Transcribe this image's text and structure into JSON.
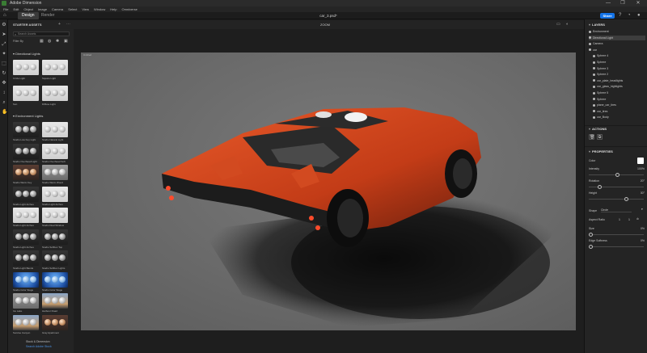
{
  "os": {
    "title": "Adobe Dimension",
    "window_controls": [
      "—",
      "❐",
      "✕"
    ]
  },
  "menu": [
    "File",
    "Edit",
    "Object",
    "Image",
    "Camera",
    "Select",
    "View",
    "Window",
    "Help",
    "Omniverse"
  ],
  "header": {
    "tabs": [
      {
        "label": "Design",
        "active": true
      },
      {
        "label": "Render",
        "active": false
      }
    ],
    "filename": "car_3.psd*",
    "share_label": "Share"
  },
  "subhead": {
    "panel_title": "STARTER ASSETS",
    "zoom": "ZOOM"
  },
  "assets": {
    "search_placeholder": "Search Assets",
    "filter_label": "Filter By",
    "section_directional": "Directional Lights",
    "directional": [
      {
        "label": "Circle Light",
        "style": "light"
      },
      {
        "label": "Square Light",
        "style": "light"
      },
      {
        "label": "Sun",
        "style": "light"
      },
      {
        "label": "Diffuse Light",
        "style": "light"
      }
    ],
    "section_environment": "Environment Lights",
    "environment": [
      {
        "label": "Studio Low Key Light",
        "style": "dark"
      },
      {
        "label": "Studio Natural Light",
        "style": "light"
      },
      {
        "label": "Studio Overhead Light",
        "style": "dark"
      },
      {
        "label": "Studio Overhead Soft",
        "style": "light"
      },
      {
        "label": "Studio Warm Key",
        "style": "warm"
      },
      {
        "label": "Studio Warm Wood",
        "style": "gray"
      },
      {
        "label": "Studio Light Arches",
        "style": "dark"
      },
      {
        "label": "Studio Light Arches",
        "style": "light"
      },
      {
        "label": "Studio Light Arches",
        "style": "light"
      },
      {
        "label": "Studio Dual Window",
        "style": "light"
      },
      {
        "label": "Studio Light Arches",
        "style": "dark"
      },
      {
        "label": "Studio Softbox Top",
        "style": "dark"
      },
      {
        "label": "Studio Light Bands",
        "style": "dark"
      },
      {
        "label": "Studio Softbox Lights",
        "style": "dark"
      },
      {
        "label": "Studio Color Stage",
        "style": "blue"
      },
      {
        "label": "Studio Color Stage",
        "style": "blue"
      },
      {
        "label": "Ice Lake",
        "style": "gray"
      },
      {
        "label": "Harbour Road",
        "style": "sunset"
      },
      {
        "label": "Sunrise Canyon",
        "style": "sunset"
      },
      {
        "label": "Gray Apartment",
        "style": "warm"
      }
    ],
    "footer_line1": "Stock & Dimension",
    "footer_line2": "Search Adobe Stock"
  },
  "canvas": {
    "artboard_label": "Untitled"
  },
  "right_panel": {
    "layers_title": "LAYERS",
    "layers": [
      {
        "label": "Environment",
        "selected": false
      },
      {
        "label": "Directional Light",
        "selected": true
      },
      {
        "label": "Camera",
        "selected": false
      },
      {
        "label": "car",
        "selected": false
      },
      {
        "label": "Sphere 4",
        "selected": false
      },
      {
        "label": "Sphere",
        "selected": false
      },
      {
        "label": "Sphere 3",
        "selected": false
      },
      {
        "label": "Sphere 2",
        "selected": false
      },
      {
        "label": "car_plate_headlights",
        "selected": false
      },
      {
        "label": "car_glass_highlights",
        "selected": false
      },
      {
        "label": "Sphere 5",
        "selected": false
      },
      {
        "label": "Sphere",
        "selected": false
      },
      {
        "label": "plane_car_tires",
        "selected": false
      },
      {
        "label": "car_tires",
        "selected": false
      },
      {
        "label": "car_Body",
        "selected": false
      }
    ],
    "actions_title": "ACTIONS",
    "properties_title": "PROPERTIES",
    "color_label": "Color",
    "intensity_label": "Intensity",
    "intensity_value": "100%",
    "rotation_label": "Rotation",
    "rotation_value": "20°",
    "height_label": "Height",
    "height_value": "30°",
    "shape_label": "Shape",
    "shape_value": "Circle",
    "aspect_label": "Aspect Ratio",
    "aspect_a": "1",
    "aspect_b": "1",
    "size_label": "Size",
    "size_value": "0%",
    "edge_label": "Edge Softness",
    "edge_value": "0%",
    "accent_color": "#1473e6",
    "car_color": "#d9471f"
  }
}
